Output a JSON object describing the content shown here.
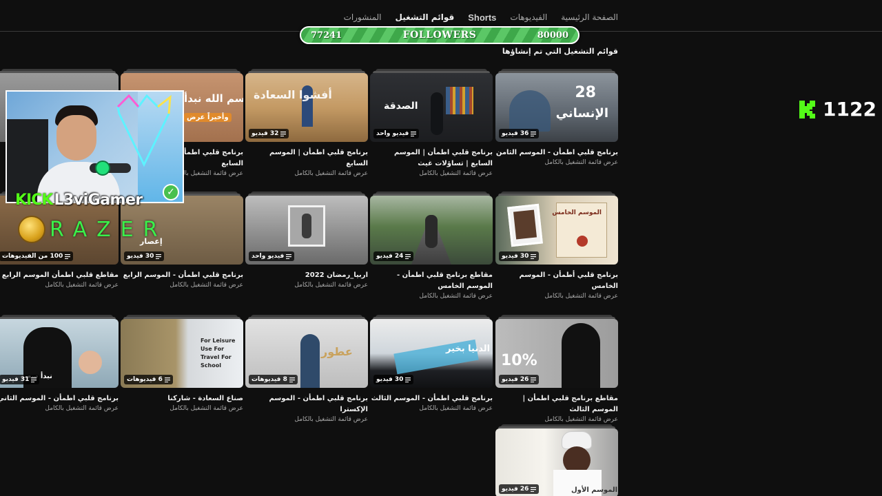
{
  "nav": {
    "tabs": [
      {
        "label": "الصفحة الرئيسية",
        "active": false
      },
      {
        "label": "الفيديوهات",
        "active": false
      },
      {
        "label": "Shorts",
        "active": false
      },
      {
        "label": "قوائم التشغيل",
        "active": true
      },
      {
        "label": "المنشورات",
        "active": false
      }
    ],
    "search_icon": "search-icon"
  },
  "followers": {
    "current": "77241",
    "label": "FOLLOWERS",
    "goal": "80000",
    "progress": 0.9655
  },
  "section_title": "قوائم التشغيل التي تم إنشاؤها",
  "view_full_label": "عرض قائمة التشغيل بالكامل",
  "rows": [
    [
      {
        "title": "برنامج قلبي اطمأن - الموسم الثامن",
        "count": "36 فيديو",
        "thumb_text": "28",
        "thumb_sub": "الإنساني",
        "theme": "rain"
      },
      {
        "title": "برنامج قلبي اطمأن | الموسم السابع | تساؤلات غيث",
        "count": "فيديو واحد",
        "thumb_text": "الصدقة",
        "theme": "room"
      },
      {
        "title": "برنامج قلبي اطمأن | الموسم السابع",
        "count": "32 فيديو",
        "thumb_text": "أفشوا السعادة",
        "theme": "desert"
      },
      {
        "title": "برنامج قلبي اطمأن | الموسم السابع",
        "count": "",
        "thumb_text": "بسم الله نبدأ",
        "thumb_sub": "وأخيراً عرض",
        "theme": "sunset"
      },
      {
        "title": "",
        "count": "",
        "thumb_text": "",
        "theme": "grey"
      }
    ],
    [
      {
        "title": "برنامج قلبي أطمأن - الموسم الخامس",
        "count": "30 فيديو",
        "thumb_text": "الموسم الخامس",
        "theme": "paper"
      },
      {
        "title": "مقاطع برنامج قلبي اطمأن - الموسم الخامس",
        "count": "24 فيديو",
        "thumb_text": "",
        "theme": "road"
      },
      {
        "title": "اربيا_رمضان 2022",
        "count": "فيديو واحد",
        "thumb_text": "",
        "theme": "frame"
      },
      {
        "title": "برنامج قلبي اطمأن - الموسم الرابع",
        "count": "30 فيديو",
        "thumb_text": "إعصار",
        "theme": "ruins"
      },
      {
        "title": "مقاطع قلبي اطمأن الموسم الرابع",
        "count": "100 من الفيديوهات",
        "thumb_text": "",
        "theme": "brown"
      }
    ],
    [
      {
        "title": "مقاطع برنامج قلبي اطمأن | الموسم الثالث",
        "count": "26 فيديو",
        "thumb_text": "10%",
        "theme": "crescent"
      },
      {
        "title": "برنامج قلبي اطمأن - الموسم الثالث",
        "count": "30 فيديو",
        "thumb_text": "الدنيا بخير",
        "theme": "sky"
      },
      {
        "title": "برنامج قلبي اطمأن - الموسم الإكسترا",
        "count": "8 فيديوهات",
        "thumb_text": "عطور",
        "theme": "mist"
      },
      {
        "title": "صناع السعادة - شاركنا",
        "count": "6 فيديوهات",
        "thumb_text": "For Leisure Use For Travel For School",
        "theme": "bag"
      },
      {
        "title": "برنامج قلبي اطمأن - الموسم الثاني",
        "count": "31 فيديو",
        "thumb_text": "نبدأ سعيد",
        "theme": "kid"
      }
    ],
    [
      {
        "title": "",
        "count": "26 فيديو",
        "thumb_text": "الموسم الأول",
        "theme": "elder"
      }
    ]
  ],
  "webcam": {
    "kick_label": "KICK",
    "username": "L3viGamer",
    "sponsor": "RAZER"
  },
  "kick_counter": {
    "value": "1122",
    "icon": "kick-logo-icon"
  },
  "colors": {
    "accent_green": "#53fc18",
    "followers_bar": "#3ea84a",
    "background": "#0f0f0f"
  }
}
